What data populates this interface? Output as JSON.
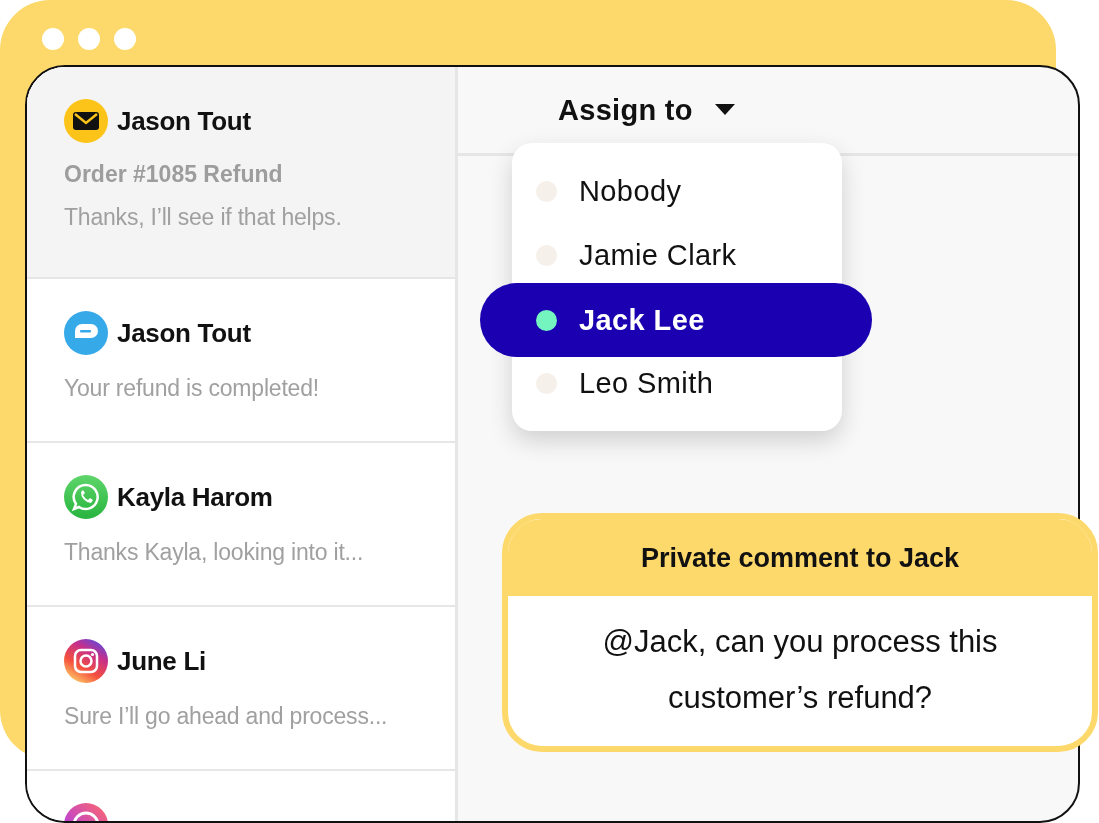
{
  "conversations": [
    {
      "kind": "email",
      "name": "Jason Tout",
      "subject": "Order #1085 Refund",
      "preview": "Thanks, I’ll see if that helps.",
      "selected": true
    },
    {
      "kind": "chat",
      "name": "Jason Tout",
      "preview": "Your refund is completed!",
      "selected": false
    },
    {
      "kind": "whatsapp",
      "name": "Kayla Harom",
      "preview": "Thanks Kayla, looking into it...",
      "selected": false
    },
    {
      "kind": "instagram",
      "name": "June Li",
      "preview": "Sure I’ll go ahead and process...",
      "selected": false
    },
    {
      "kind": "messenger",
      "selected": false
    }
  ],
  "assign": {
    "label": "Assign to",
    "options": [
      {
        "name": "Nobody",
        "selected": false
      },
      {
        "name": "Jamie Clark",
        "selected": false
      },
      {
        "name": "Jack Lee",
        "selected": true
      },
      {
        "name": "Leo Smith",
        "selected": false
      }
    ]
  },
  "comment": {
    "title": "Private comment to Jack",
    "text": "@Jack, can you process this customer’s refund?"
  }
}
